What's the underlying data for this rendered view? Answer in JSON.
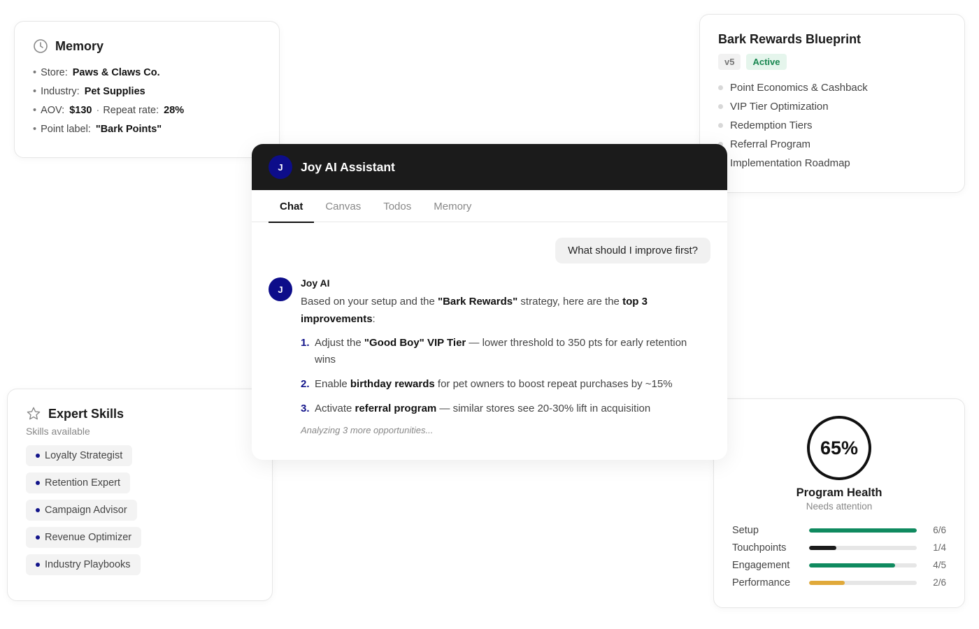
{
  "memory": {
    "title": "Memory",
    "icon": "clock-icon",
    "store_label": "Store:",
    "store_value": "Paws & Claws Co.",
    "industry_label": "Industry:",
    "industry_value": "Pet Supplies",
    "aov_label": "AOV:",
    "aov_value": "$130",
    "separator": "·",
    "repeat_label": "Repeat rate:",
    "repeat_value": "28%",
    "point_label": "Point label:",
    "point_value": "\"Bark Points\""
  },
  "blueprint": {
    "title": "Bark Rewards Blueprint",
    "version": "v5",
    "status": "Active",
    "items": [
      "Point Economics & Cashback",
      "VIP Tier Optimization",
      "Redemption Tiers",
      "Referral Program",
      "Implementation Roadmap"
    ]
  },
  "skills": {
    "title": "Expert Skills",
    "icon": "star-icon",
    "subtitle": "Skills available",
    "items": [
      "Loyalty Strategist",
      "Retention Expert",
      "Campaign Advisor",
      "Revenue Optimizer",
      "Industry Playbooks"
    ]
  },
  "health": {
    "score": "65%",
    "score_fraction": 0.65,
    "title": "Program Health",
    "subtitle": "Needs attention",
    "metrics": [
      {
        "label": "Setup",
        "value": "6/6",
        "fraction": 1.0,
        "color": "#0f8a5f"
      },
      {
        "label": "Touchpoints",
        "value": "1/4",
        "fraction": 0.25,
        "color": "#1b1b1b"
      },
      {
        "label": "Engagement",
        "value": "4/5",
        "fraction": 0.8,
        "color": "#0f8a5f"
      },
      {
        "label": "Performance",
        "value": "2/6",
        "fraction": 0.333,
        "color": "#e0a93a"
      }
    ]
  },
  "chat": {
    "avatar_letter": "J",
    "title": "Joy AI Assistant",
    "tabs": [
      "Chat",
      "Canvas",
      "Todos",
      "Memory"
    ],
    "active_tab": "Chat",
    "user_message": "What should I improve first?",
    "ai_name": "Joy AI",
    "intro": {
      "t1": "Based on your setup and the ",
      "b1": "\"Bark Rewards\"",
      "t2": " strategy, here are the ",
      "b2": "top 3 improvements",
      "t3": ":"
    },
    "tips": [
      {
        "num": "1.",
        "pre": "Adjust the ",
        "bold": "\"Good Boy\" VIP Tier",
        "post": " — lower threshold to 350 pts for early retention wins"
      },
      {
        "num": "2.",
        "pre": "Enable ",
        "bold": "birthday rewards",
        "post": " for pet owners to boost repeat purchases by ~15%"
      },
      {
        "num": "3.",
        "pre": "Activate ",
        "bold": "referral program",
        "post": " — similar stores see 20-30% lift in acquisition"
      }
    ],
    "status": "Analyzing 3 more opportunities..."
  },
  "colors": {
    "accent_navy": "#12148a",
    "header_dark": "#1b1b1b",
    "active_green": "#17864f"
  }
}
